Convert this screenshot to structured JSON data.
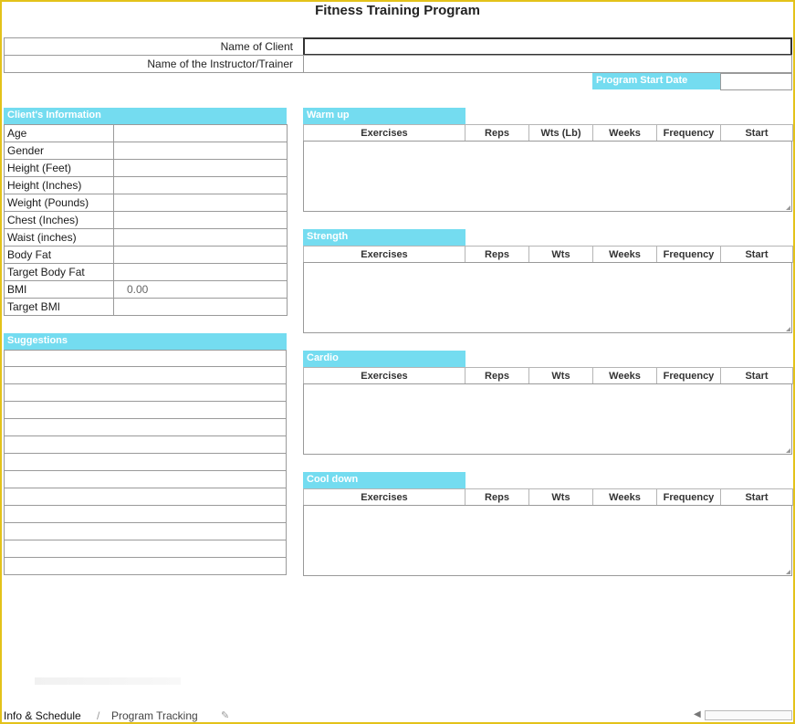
{
  "header": {
    "title": "Fitness Training Program"
  },
  "top_fields": {
    "client_label": "Name of Client",
    "client_value": "",
    "trainer_label": "Name of the Instructor/Trainer",
    "trainer_value": "",
    "start_date_label": "Program Start Date",
    "start_date_value": ""
  },
  "client_info": {
    "header": "Client's Information",
    "rows": [
      {
        "label": "Age",
        "value": ""
      },
      {
        "label": "Gender",
        "value": ""
      },
      {
        "label": "Height (Feet)",
        "value": ""
      },
      {
        "label": "Height (Inches)",
        "value": ""
      },
      {
        "label": "Weight (Pounds)",
        "value": ""
      },
      {
        "label": "Chest (Inches)",
        "value": ""
      },
      {
        "label": "Waist (inches)",
        "value": ""
      },
      {
        "label": "Body Fat",
        "value": ""
      },
      {
        "label": "Target Body Fat",
        "value": ""
      },
      {
        "label": "BMI",
        "value": "0.00"
      },
      {
        "label": "Target BMI",
        "value": ""
      }
    ]
  },
  "suggestions": {
    "header": "Suggestions",
    "line_count": 13
  },
  "sections": [
    {
      "name": "Warm up",
      "columns": [
        "Exercises",
        "Reps",
        "Wts (Lb)",
        "Weeks",
        "Frequency",
        "Start"
      ]
    },
    {
      "name": "Strength",
      "columns": [
        "Exercises",
        "Reps",
        "Wts",
        "Weeks",
        "Frequency",
        "Start"
      ]
    },
    {
      "name": "Cardio",
      "columns": [
        "Exercises",
        "Reps",
        "Wts",
        "Weeks",
        "Frequency",
        "Start"
      ]
    },
    {
      "name": "Cool down",
      "columns": [
        "Exercises",
        "Reps",
        "Wts",
        "Weeks",
        "Frequency",
        "Start"
      ]
    }
  ],
  "tabs": {
    "active": "Info & Schedule",
    "other": "Program Tracking"
  },
  "colors": {
    "accent": "#74dcf0",
    "frame": "#e3c21a",
    "grid": "#9a9a9a"
  }
}
